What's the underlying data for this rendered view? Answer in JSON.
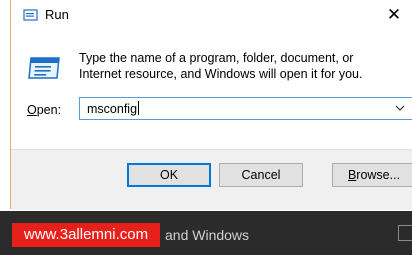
{
  "dialog": {
    "title": "Run",
    "close_glyph": "✕",
    "description": "Type the name of a program, folder, document, or Internet resource, and Windows will open it for you.",
    "open_label_prefix": "O",
    "open_label_rest": "pen:",
    "open_value": "msconfig",
    "buttons": {
      "ok": "OK",
      "cancel": "Cancel",
      "browse_prefix": "B",
      "browse_rest": "rowse..."
    }
  },
  "taskbar": {
    "text": "and Windows"
  },
  "watermark": {
    "text": "www.3allemni.com"
  },
  "colors": {
    "accent": "#0078d7",
    "watermark_bg": "#e8201b",
    "taskbar_bg": "#2b2b2b"
  },
  "icons": [
    "run-icon",
    "run-large-icon",
    "close-icon",
    "chevron-down-icon"
  ]
}
